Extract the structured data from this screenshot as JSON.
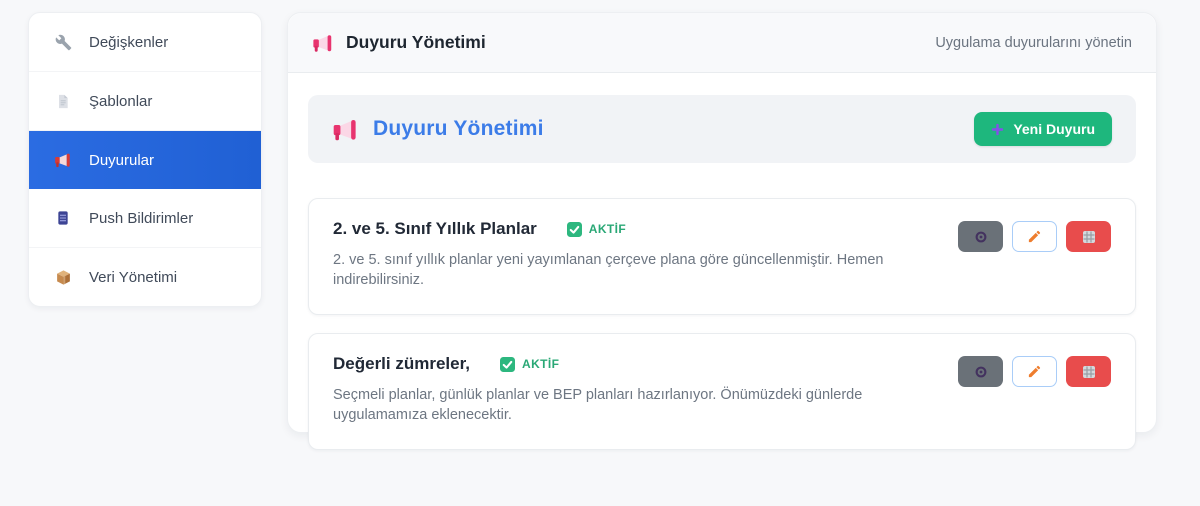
{
  "sidebar": {
    "items": [
      {
        "label": "Değişkenler",
        "icon": "wrench-icon",
        "active": false
      },
      {
        "label": "Şablonlar",
        "icon": "document-icon",
        "active": false
      },
      {
        "label": "Duyurular",
        "icon": "megaphone-icon",
        "active": true
      },
      {
        "label": "Push Bildirimler",
        "icon": "phone-icon",
        "active": false
      },
      {
        "label": "Veri Yönetimi",
        "icon": "package-icon",
        "active": false
      }
    ]
  },
  "header": {
    "title": "Duyuru Yönetimi",
    "subtitle": "Uygulama duyurularını yönetin"
  },
  "toolbar": {
    "title": "Duyuru Yönetimi",
    "new_button_label": "Yeni Duyuru"
  },
  "announcements": [
    {
      "title": "2. ve 5. Sınıf Yıllık Planlar",
      "status": "AKTİF",
      "description": "2. ve 5. sınıf yıllık planlar yeni yayımlanan çerçeve plana göre güncellenmiştir. Hemen indirebilirsiniz."
    },
    {
      "title": "Değerli zümreler,",
      "status": "AKTİF",
      "description": "Seçmeli planlar, günlük planlar ve BEP planları hazırlanıyor. Önümüzdeki günlerde uygulamamıza eklenecektir."
    }
  ],
  "colors": {
    "sidebar_active_blue": "#2465dd",
    "toolbar_title_blue": "#3c7ce8",
    "new_button_green": "#1eb77d",
    "badge_green": "#2aa876",
    "edit_button_border_blue": "#a9cdf8",
    "delete_button_red": "#e84c4c",
    "secondary_button_gray": "#6a7178"
  }
}
